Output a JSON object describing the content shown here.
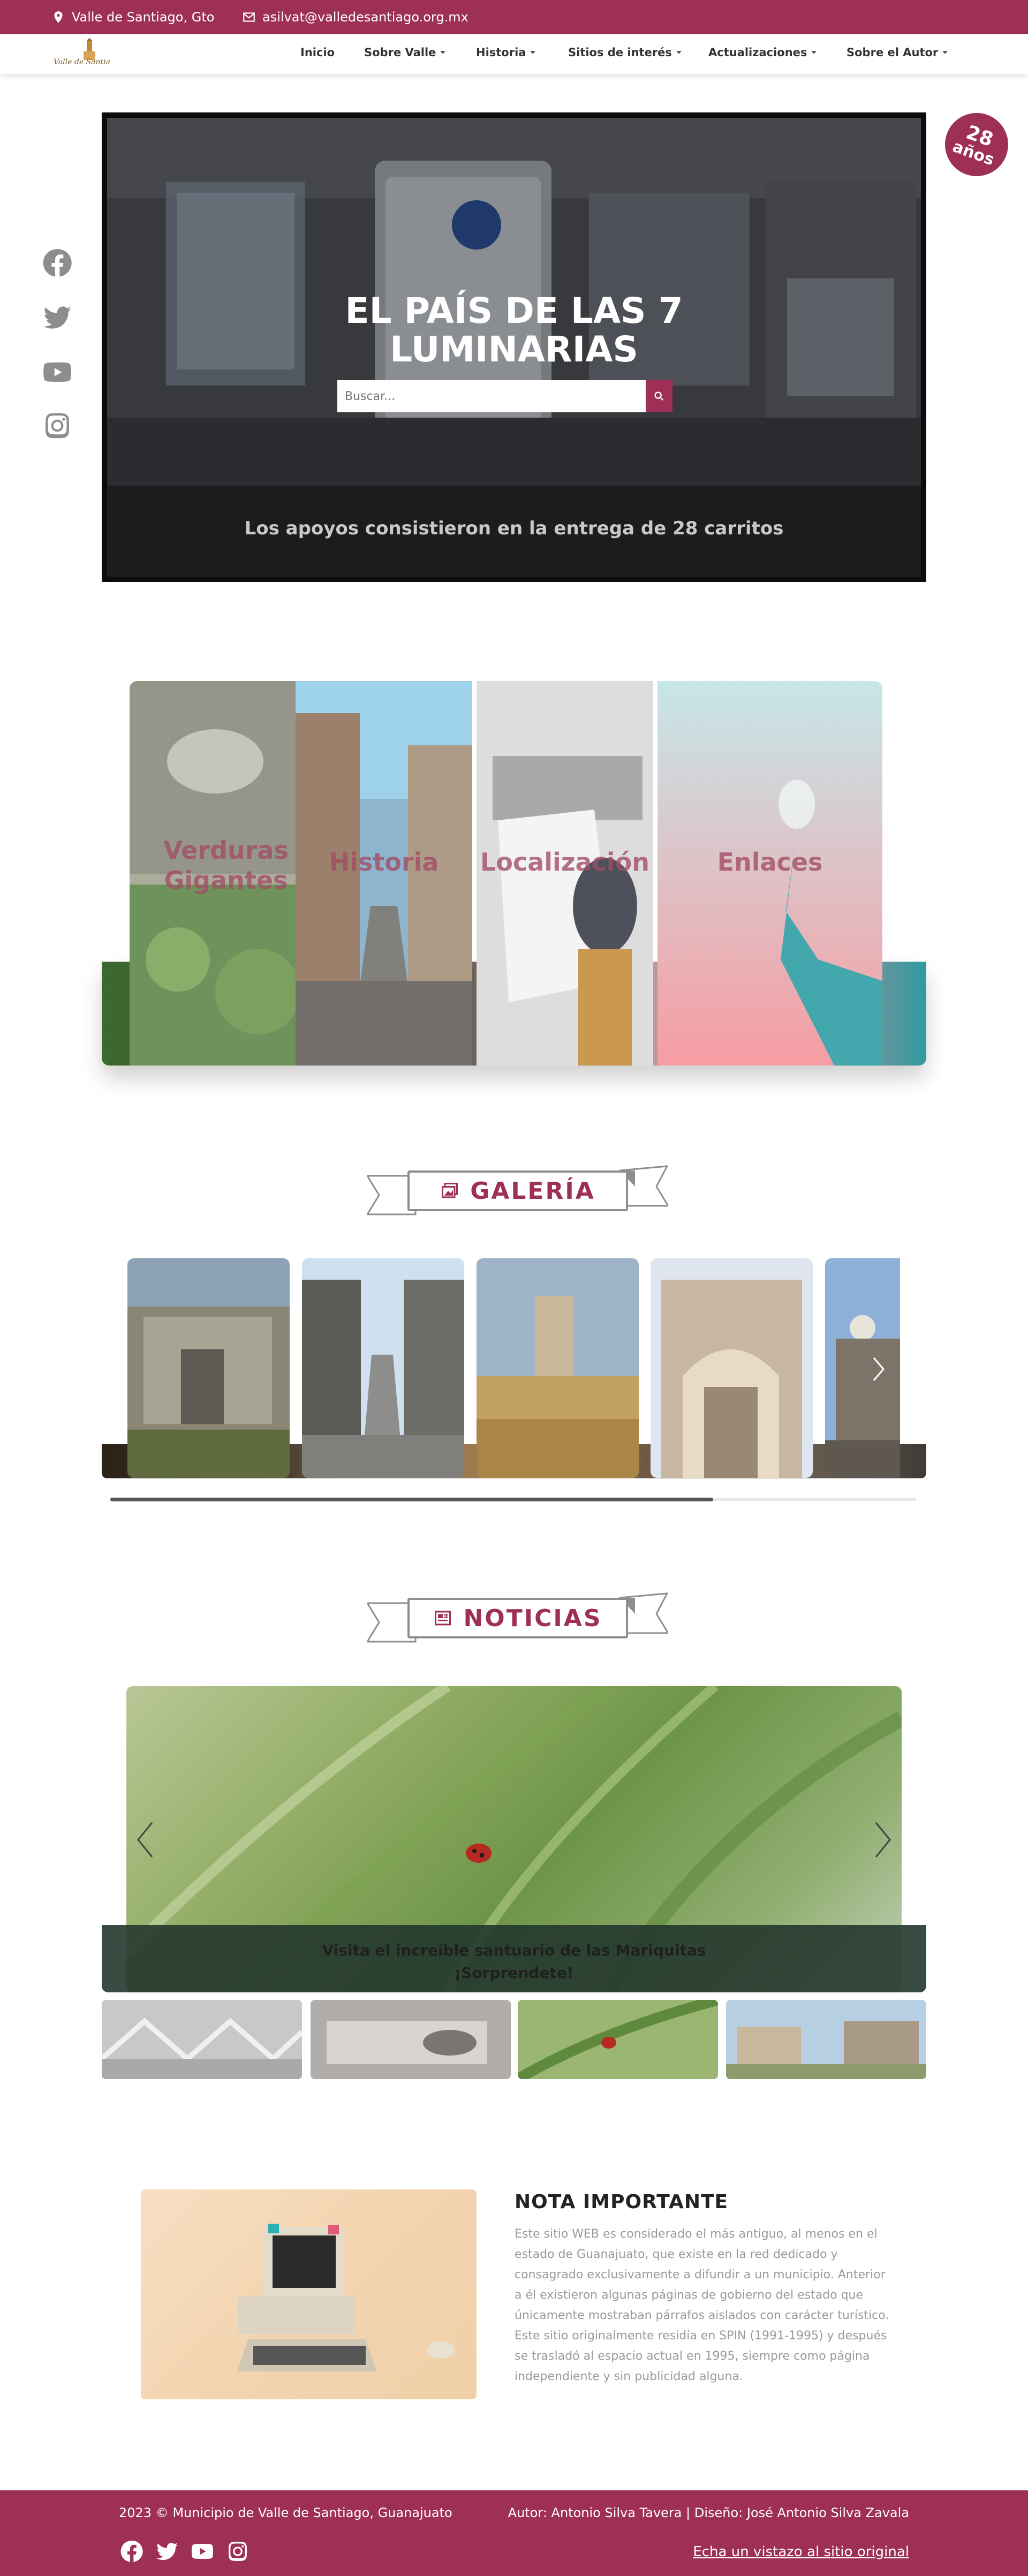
{
  "topbar": {
    "location": "Valle de Santiago, Gto",
    "email": "asilvat@valledesantiago.org.mx",
    "icons": [
      "location-pin-icon",
      "envelope-icon"
    ]
  },
  "nav": {
    "logo_text": "Valle de Santiago",
    "items": [
      {
        "label": "Inicio",
        "dropdown": false
      },
      {
        "label": "Sobre Valle",
        "dropdown": true
      },
      {
        "label": "Historia",
        "dropdown": true
      },
      {
        "label": "Sitios de interés",
        "dropdown": true
      },
      {
        "label": "Actualizaciones",
        "dropdown": true
      },
      {
        "label": "Sobre el Autor",
        "dropdown": true
      }
    ]
  },
  "badge": {
    "number": "28",
    "text": "años"
  },
  "social_side": [
    "facebook-icon",
    "twitter-icon",
    "youtube-icon",
    "instagram-icon"
  ],
  "hero": {
    "title_line1": "EL PAÍS DE LAS 7",
    "title_line2": "LUMINARIAS",
    "search_placeholder": "Buscar...",
    "caption": "Los apoyos consistieron en la entrega de 28 carritos"
  },
  "cards": [
    {
      "label_line1": "Verduras",
      "label_line2": "Gigantes"
    },
    {
      "label_line1": "Historia",
      "label_line2": ""
    },
    {
      "label_line1": "Localización",
      "label_line2": ""
    },
    {
      "label_line1": "Enlaces",
      "label_line2": ""
    }
  ],
  "gallery": {
    "title": "GALERÍA",
    "scroll_progress": 0.75
  },
  "news": {
    "title": "NOTICIAS",
    "caption_line1": "Visita el increíble santuario de las Mariquitas",
    "caption_line2": "¡Sorprendete!"
  },
  "note": {
    "title": "NOTA IMPORTANTE",
    "text": "Este sitio WEB es considerado el más antiguo, al menos en el estado de Guanajuato, que existe en la red dedicado y consagrado exclusivamente a difundir a un municipio. Anterior a él existieron algunas páginas de gobierno del estado que únicamente mostraban párrafos aislados con carácter turístico. Este sitio originalmente residía en SPIN (1991-1995) y después se trasladó al espacio actual en 1995, siempre como página independiente y sin publicidad alguna."
  },
  "footer": {
    "copyright": "2023 © Municipio de Valle de Santiago, Guanajuato",
    "credit": "Autor: Antonio Silva Tavera | Diseño: José Antonio Silva Zavala",
    "link": "Echa un vistazo al sitio original",
    "icons": [
      "facebook-icon",
      "twitter-icon",
      "youtube-icon",
      "instagram-icon"
    ]
  },
  "colors": {
    "brand": "#9e2f57",
    "card_label": "#a24c67",
    "icon_gray": "#8d8d8d"
  }
}
